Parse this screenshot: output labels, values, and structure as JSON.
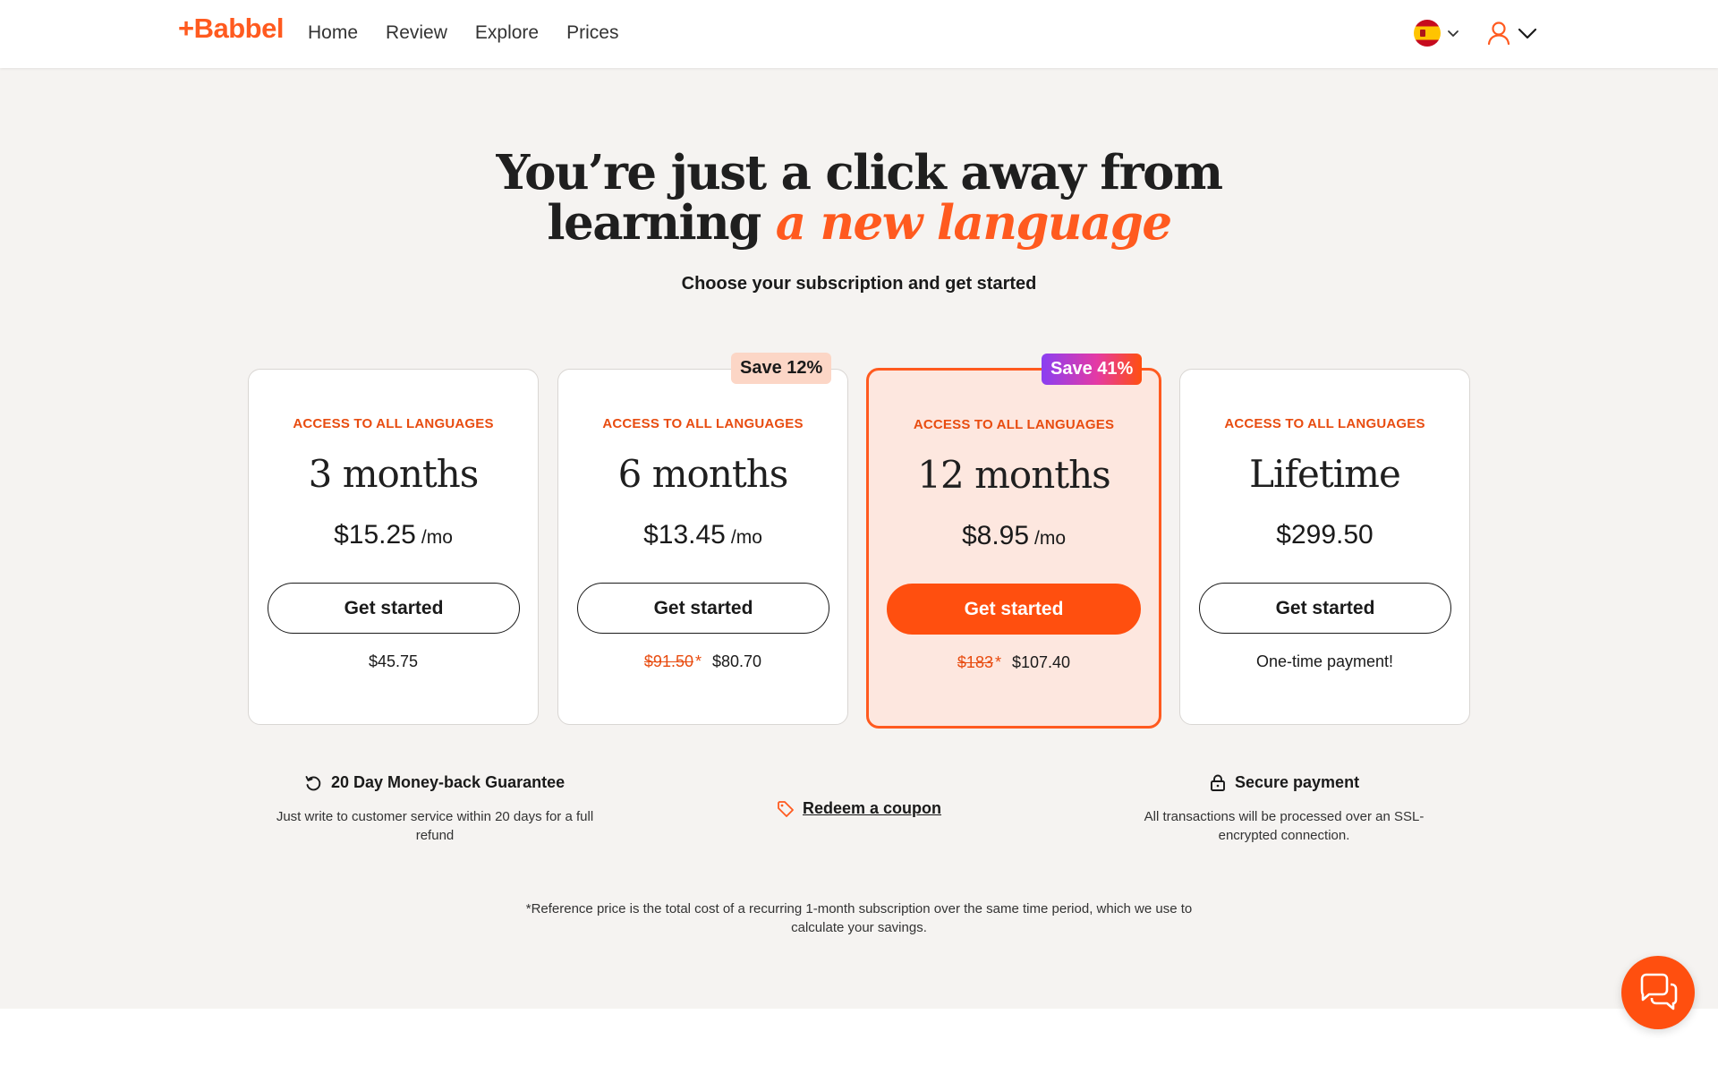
{
  "brand": {
    "logo": "+Babbel",
    "accent_color": "#ff5a1f"
  },
  "nav": {
    "items": [
      "Home",
      "Review",
      "Explore",
      "Prices"
    ]
  },
  "header": {
    "language_flag_icon": "spain-flag-icon",
    "user_icon": "user-icon"
  },
  "hero": {
    "title_line1": "You’re just a click away from",
    "title_line2_plain": "learning ",
    "title_line2_accent": "a new language",
    "subtitle": "Choose your subscription and get started"
  },
  "plans": [
    {
      "access": "ACCESS TO ALL LANGUAGES",
      "term": "3 months",
      "price": "$15.25",
      "per": "/mo",
      "cta": "Get started",
      "total": "$45.75"
    },
    {
      "badge": "Save 12%",
      "access": "ACCESS TO ALL LANGUAGES",
      "term": "6 months",
      "price": "$13.45",
      "per": "/mo",
      "cta": "Get started",
      "ref_price": "$91.50",
      "ref_mark": "*",
      "total": "$80.70"
    },
    {
      "badge": "Save 41%",
      "access": "ACCESS TO ALL LANGUAGES",
      "term": "12 months",
      "price": "$8.95",
      "per": "/mo",
      "cta": "Get started",
      "ref_price": "$183",
      "ref_mark": "*",
      "total": "$107.40",
      "highlighted": true
    },
    {
      "access": "ACCESS TO ALL LANGUAGES",
      "term": "Lifetime",
      "price": "$299.50",
      "cta": "Get started",
      "total": "One-time payment!"
    }
  ],
  "features": {
    "guarantee": {
      "title": "20 Day Money-back Guarantee",
      "body": "Just write to customer service within 20 days for a full refund"
    },
    "coupon": {
      "label": "Redeem a coupon"
    },
    "secure": {
      "title": "Secure payment",
      "body": "All transactions will be processed over an SSL-encrypted connection."
    }
  },
  "footnote": "*Reference price is the total cost of a recurring 1-month subscription over the same time period, which we use to calculate your savings.",
  "chat": {
    "icon": "chat-bubbles-icon"
  }
}
